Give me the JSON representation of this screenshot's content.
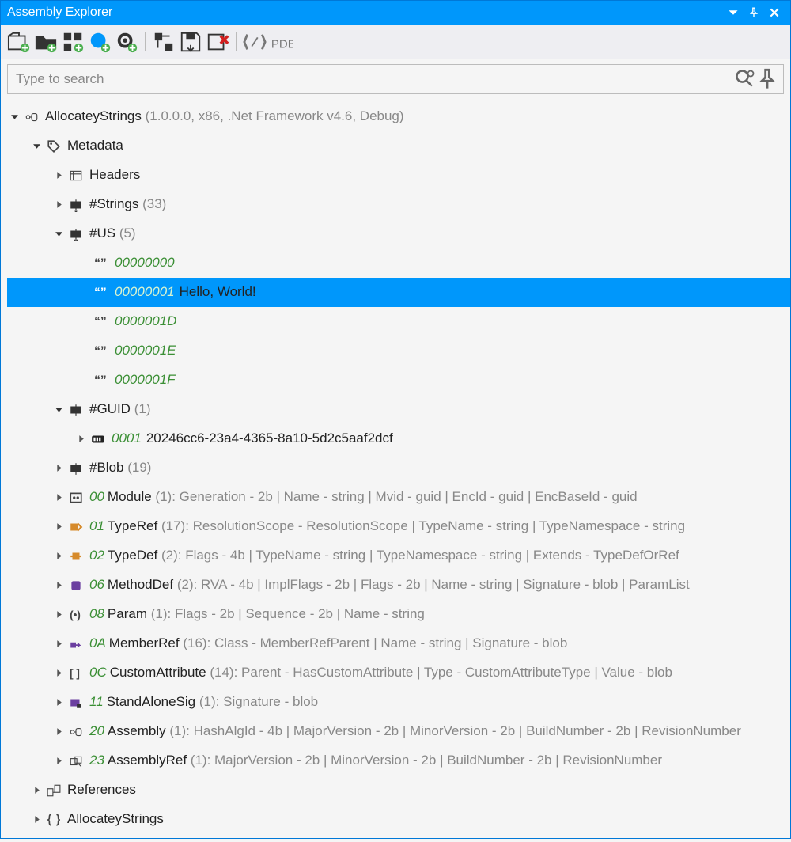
{
  "window": {
    "title": "Assembly Explorer"
  },
  "search": {
    "placeholder": "Type to search"
  },
  "root": {
    "name": "AllocateyStrings",
    "info": "(1.0.0.0, x86, .Net Framework v4.6, Debug)"
  },
  "metadata_label": "Metadata",
  "headers_label": "Headers",
  "strings": {
    "label": "#Strings",
    "count": "(33)"
  },
  "us": {
    "label": "#US",
    "count": "(5)",
    "items": [
      {
        "addr": "00000000",
        "text": ""
      },
      {
        "addr": "00000001",
        "text": "Hello, World!"
      },
      {
        "addr": "0000001D",
        "text": ""
      },
      {
        "addr": "0000001E",
        "text": ""
      },
      {
        "addr": "0000001F",
        "text": ""
      }
    ]
  },
  "guid": {
    "label": "#GUID",
    "count": "(1)",
    "item": {
      "addr": "0001",
      "text": "20246cc6-23a4-4365-8a10-5d2c5aaf2dcf"
    }
  },
  "blob": {
    "label": "#Blob",
    "count": "(19)"
  },
  "tables": [
    {
      "idx": "00",
      "name": "Module",
      "count": "(1)",
      "detail": ": Generation - 2b | Name - string | Mvid - guid | EncId - guid | EncBaseId - guid",
      "icon": "module"
    },
    {
      "idx": "01",
      "name": "TypeRef",
      "count": "(17)",
      "detail": ": ResolutionScope - ResolutionScope | TypeName - string | TypeNamespace - string",
      "icon": "typeref"
    },
    {
      "idx": "02",
      "name": "TypeDef",
      "count": "(2)",
      "detail": ": Flags - 4b | TypeName - string | TypeNamespace - string | Extends - TypeDefOrRef",
      "icon": "typedef"
    },
    {
      "idx": "06",
      "name": "MethodDef",
      "count": "(2)",
      "detail": ": RVA - 4b | ImplFlags - 2b | Flags - 2b | Name - string | Signature - blob | ParamList",
      "icon": "method"
    },
    {
      "idx": "08",
      "name": "Param",
      "count": "(1)",
      "detail": ": Flags - 2b | Sequence - 2b | Name - string",
      "icon": "param"
    },
    {
      "idx": "0A",
      "name": "MemberRef",
      "count": "(16)",
      "detail": ": Class - MemberRefParent | Name - string | Signature - blob",
      "icon": "memberref"
    },
    {
      "idx": "0C",
      "name": "CustomAttribute",
      "count": "(14)",
      "detail": ": Parent - HasCustomAttribute | Type - CustomAttributeType | Value - blob",
      "icon": "attr"
    },
    {
      "idx": "11",
      "name": "StandAloneSig",
      "count": "(1)",
      "detail": ": Signature - blob",
      "icon": "sig"
    },
    {
      "idx": "20",
      "name": "Assembly",
      "count": "(1)",
      "detail": ": HashAlgId - 4b | MajorVersion - 2b | MinorVersion - 2b | BuildNumber - 2b | RevisionNumber",
      "icon": "asm"
    },
    {
      "idx": "23",
      "name": "AssemblyRef",
      "count": "(1)",
      "detail": ": MajorVersion - 2b | MinorVersion - 2b | BuildNumber - 2b | RevisionNumber",
      "icon": "asmref"
    }
  ],
  "references_label": "References",
  "namespace_label": "AllocateyStrings"
}
